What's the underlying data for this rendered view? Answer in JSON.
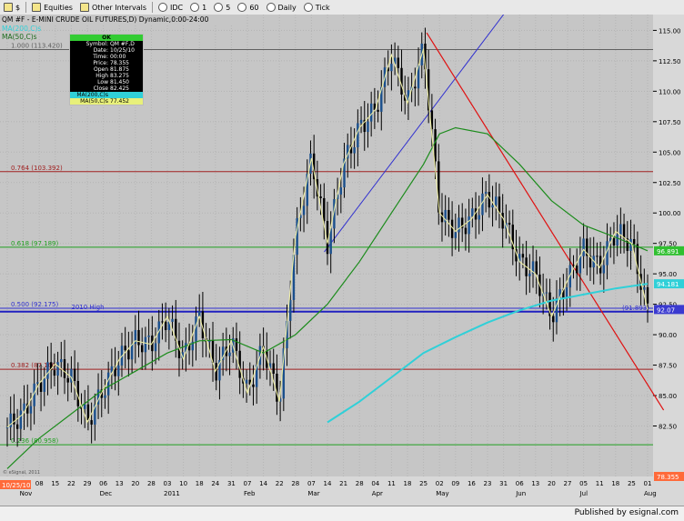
{
  "toolbar": {
    "items": [
      {
        "label": "$",
        "icon": "nav-icon"
      },
      {
        "label": "Equities",
        "icon": "folder-icon"
      },
      {
        "label": "Other Intervals",
        "icon": "folder-icon"
      },
      {
        "label": "IDC",
        "icon": "radio-icon"
      },
      {
        "label": "1",
        "icon": "radio-icon"
      },
      {
        "label": "5",
        "icon": "radio-icon"
      },
      {
        "label": "60",
        "icon": "radio-icon"
      },
      {
        "label": "Daily",
        "icon": "radio-icon"
      },
      {
        "label": "Tick",
        "icon": "radio-icon"
      }
    ]
  },
  "chart": {
    "title": "QM #F - E-MINI CRUDE OIL FUTURES,D) Dynamic,0:00-24:00",
    "ma_label_1": "MA(200,C)s",
    "ma_label_2": "MA(50,C)s",
    "fib_labels": [
      {
        "text": "1.000 (113.420)",
        "value": 113.42
      },
      {
        "text": "0.764 (103.392)",
        "value": 103.392
      },
      {
        "text": "0.618 (97.189)",
        "value": 97.189
      },
      {
        "text": "0.500 (92.175)",
        "value": 92.175
      },
      {
        "text": "0.382 (87.160)",
        "value": 87.16
      },
      {
        "text": "0.236 (80.958)",
        "value": 80.958
      }
    ],
    "annotation_2010_high": "2010 High",
    "level_label": "(91.893)",
    "price_tags": [
      {
        "text": "96.891",
        "value": 96.891,
        "color": "#30c030"
      },
      {
        "text": "94.181",
        "value": 94.181,
        "color": "#30d0d8"
      },
      {
        "text": "92.07",
        "value": 92.07,
        "color": "#3a3ad0"
      },
      {
        "text": "78.355",
        "value": 78.355,
        "color": "#ff6a3a"
      }
    ],
    "current_date_tag": "10/25/10",
    "watermark": "© eSignal, 2011",
    "colors": {
      "panel": "#c6c6c6",
      "up_bar": "#1a4f8c",
      "down_bar": "#000000",
      "ma200": "#30d0d8",
      "ma50": "#1c8c1c",
      "ma_short": "#f0f0a0",
      "downtrend": "#e01010",
      "uptrend": "#3030d0",
      "horizontal_blue": "#2020c0"
    }
  },
  "data_window": {
    "header": "OK",
    "rows": [
      {
        "label": "Symbol:",
        "value": "QM #F,D"
      },
      {
        "label": "Date:",
        "value": "10/25/10"
      },
      {
        "label": "Time:",
        "value": "00:00"
      },
      {
        "label": "Price:",
        "value": "78.355"
      },
      {
        "label": "Open",
        "value": "81.875"
      },
      {
        "label": "High",
        "value": "83.275"
      },
      {
        "label": "Low",
        "value": "81.450"
      },
      {
        "label": "Close",
        "value": "82.425"
      }
    ],
    "ma1": {
      "label": "MA(200,C)s",
      "value": ""
    },
    "ma2": {
      "label": "MA(50,C)s",
      "value": "77.452"
    }
  },
  "chart_data": {
    "type": "line",
    "y_ticks": [
      82.5,
      85.0,
      87.5,
      90.0,
      92.5,
      95.0,
      97.5,
      100.0,
      102.5,
      105.0,
      107.5,
      110.0,
      112.5,
      115.0
    ],
    "y_tick_labels": [
      "82.50",
      "85.00",
      "87.50",
      "90.00",
      "92.50",
      "95.00",
      "97.50",
      "100.00",
      "102.50",
      "105.00",
      "107.50",
      "110.00",
      "112.50",
      "115.00"
    ],
    "ylim": [
      78.355,
      116.3
    ],
    "x_ticks": [
      "25",
      "01",
      "08",
      "15",
      "22",
      "29",
      "06",
      "13",
      "20",
      "28",
      "03",
      "10",
      "18",
      "24",
      "31",
      "07",
      "14",
      "22",
      "28",
      "07",
      "14",
      "21",
      "28",
      "04",
      "11",
      "18",
      "25",
      "02",
      "09",
      "16",
      "23",
      "31",
      "06",
      "13",
      "20",
      "27",
      "05",
      "11",
      "18",
      "25",
      "01"
    ],
    "month_labels": [
      {
        "label": "Nov",
        "tick_index": 1
      },
      {
        "label": "Dec",
        "tick_index": 6
      },
      {
        "label": "2011",
        "tick_index": 10
      },
      {
        "label": "Feb",
        "tick_index": 15
      },
      {
        "label": "Mar",
        "tick_index": 19
      },
      {
        "label": "Apr",
        "tick_index": 23
      },
      {
        "label": "May",
        "tick_index": 27
      },
      {
        "label": "Jun",
        "tick_index": 32
      },
      {
        "label": "Jul",
        "tick_index": 36
      },
      {
        "label": "Aug",
        "tick_index": 40
      }
    ],
    "close_path": [
      [
        0,
        82.4
      ],
      [
        1,
        83.5
      ],
      [
        2,
        86.0
      ],
      [
        3,
        87.6
      ],
      [
        4,
        86.5
      ],
      [
        5,
        82.8
      ],
      [
        6,
        85.5
      ],
      [
        7,
        88.0
      ],
      [
        8,
        89.5
      ],
      [
        9,
        89.2
      ],
      [
        10,
        91.5
      ],
      [
        11,
        88.0
      ],
      [
        12,
        91.5
      ],
      [
        13,
        87.0
      ],
      [
        14,
        89.5
      ],
      [
        15,
        85.2
      ],
      [
        16,
        89.0
      ],
      [
        17,
        84.5
      ],
      [
        18,
        98.0
      ],
      [
        19,
        104.5
      ],
      [
        20,
        97.5
      ],
      [
        21,
        104.0
      ],
      [
        22,
        107.0
      ],
      [
        23,
        108.5
      ],
      [
        24,
        113.0
      ],
      [
        25,
        109.0
      ],
      [
        26,
        113.5
      ],
      [
        27,
        100.0
      ],
      [
        28,
        98.5
      ],
      [
        29,
        99.5
      ],
      [
        30,
        101.5
      ],
      [
        31,
        99.5
      ],
      [
        32,
        96.0
      ],
      [
        33,
        95.0
      ],
      [
        34,
        91.5
      ],
      [
        35,
        94.5
      ],
      [
        36,
        97.0
      ],
      [
        37,
        95.5
      ],
      [
        38,
        98.5
      ],
      [
        39,
        97.5
      ],
      [
        40,
        92.07
      ]
    ],
    "ma50_path": [
      [
        0,
        79.0
      ],
      [
        2,
        81.5
      ],
      [
        4,
        83.5
      ],
      [
        6,
        85.5
      ],
      [
        8,
        87.0
      ],
      [
        10,
        88.5
      ],
      [
        12,
        89.5
      ],
      [
        14,
        89.6
      ],
      [
        16,
        88.5
      ],
      [
        18,
        90.0
      ],
      [
        20,
        92.5
      ],
      [
        22,
        96.0
      ],
      [
        24,
        100.0
      ],
      [
        26,
        104.0
      ],
      [
        27,
        106.5
      ],
      [
        28,
        107.0
      ],
      [
        30,
        106.5
      ],
      [
        32,
        104.0
      ],
      [
        34,
        101.0
      ],
      [
        36,
        99.0
      ],
      [
        38,
        98.0
      ],
      [
        40,
        96.891
      ]
    ],
    "ma200_path": [
      [
        20,
        82.8
      ],
      [
        22,
        84.5
      ],
      [
        24,
        86.5
      ],
      [
        26,
        88.5
      ],
      [
        28,
        89.8
      ],
      [
        30,
        91.0
      ],
      [
        32,
        92.0
      ],
      [
        34,
        92.8
      ],
      [
        36,
        93.3
      ],
      [
        38,
        93.8
      ],
      [
        40,
        94.181
      ]
    ],
    "downtrend_line": [
      [
        26.2,
        114.8
      ],
      [
        41.0,
        83.8
      ]
    ],
    "uptrend_line": [
      [
        19.8,
        96.8
      ],
      [
        31.0,
        116.3
      ]
    ],
    "hline_2010_high": 91.893
  }
}
